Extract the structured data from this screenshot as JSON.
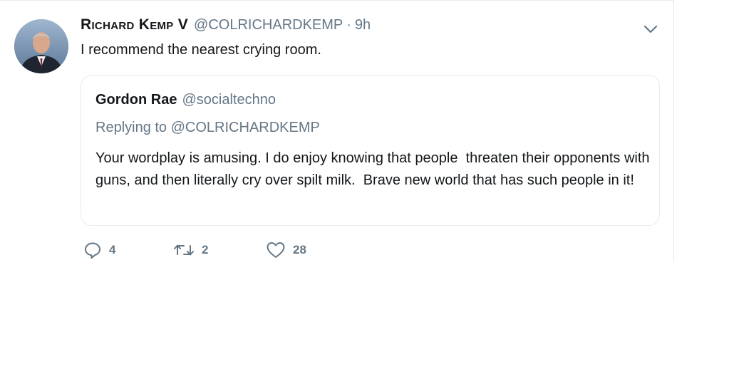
{
  "tweet": {
    "display_name": "Richard Kemp V",
    "handle": "@COLRICHARDKEMP",
    "separator": "·",
    "timestamp": "9h",
    "text": "I recommend the nearest crying room.",
    "avatar_icon": "user-photo-avatar",
    "menu_icon": "chevron-down-icon"
  },
  "quoted_tweet": {
    "display_name": "Gordon Rae",
    "handle": "@socialtechno",
    "replying_prefix": "Replying to",
    "replying_handle": "@COLRICHARDKEMP",
    "text": "Your wordplay is amusing. I do enjoy knowing that people  threaten their opponents with guns, and then literally cry over spilt milk.  Brave new world that has such people in it!"
  },
  "actions": {
    "replies": "4",
    "retweets": "2",
    "likes": "28",
    "reply_icon": "comment-bubble-icon",
    "retweet_icon": "retweet-arrows-icon",
    "like_icon": "heart-icon"
  },
  "colors": {
    "text": "#14171a",
    "secondary": "#657786",
    "border": "#e6ecf0"
  }
}
